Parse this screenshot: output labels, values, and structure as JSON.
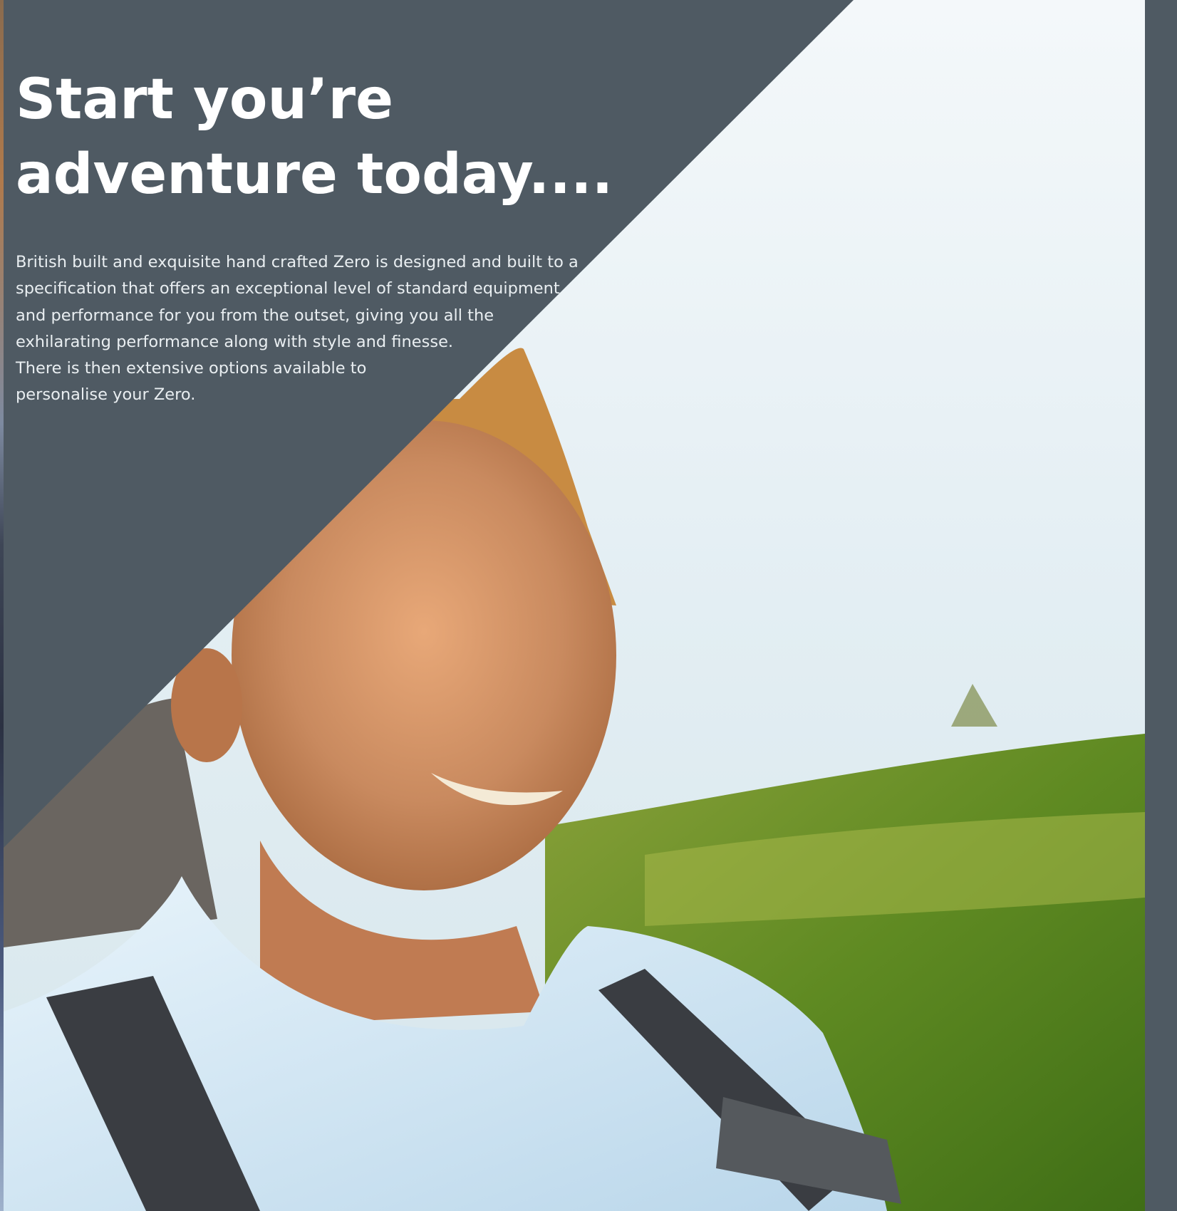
{
  "headline": "Start you’re adventure today....",
  "body": "British built and exquisite hand crafted Zero is designed and built to  a\nspecification that offers an exceptional level of standard equipment\nand performance for you from the outset, giving you all the\nexhilarating performance along with style and finesse.\nThere is then extensive options available to\npersonalise your Zero.",
  "colors": {
    "panel": "#4f5a63",
    "text": "#ffffff"
  }
}
